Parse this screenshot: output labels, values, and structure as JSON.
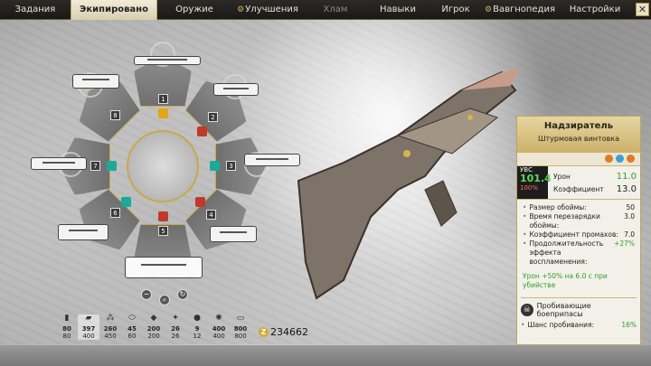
{
  "tabs": [
    {
      "label": "Задания",
      "state": "normal"
    },
    {
      "label": "Экипировано",
      "state": "active"
    },
    {
      "label": "Оружие",
      "state": "normal"
    },
    {
      "label": "Улучшения",
      "state": "normal",
      "icon": "gear-icon"
    },
    {
      "label": "Хлам",
      "state": "dim"
    },
    {
      "label": "Навыки",
      "state": "normal"
    },
    {
      "label": "Игрок",
      "state": "normal"
    },
    {
      "label": "Вавгнопедия",
      "state": "normal",
      "icon": "gear-icon"
    },
    {
      "label": "Настройки",
      "state": "normal"
    }
  ],
  "wheel": {
    "slots": [
      "1",
      "2",
      "3",
      "4",
      "5",
      "6",
      "7",
      "8"
    ],
    "center_buttons": [
      "−",
      "⌕",
      "↻"
    ]
  },
  "weapon": {
    "name": "Надзиратель",
    "type": "Штурмовая винтовка",
    "uvs_label": "УВС",
    "uvs_value": "101.4",
    "uvs_pct": "100%",
    "damage_label": "Урон",
    "damage_value": "11.0",
    "coef_label": "Коэффициент",
    "coef_value": "13.0",
    "stats": [
      {
        "label": "Размер обоймы:",
        "value": "50"
      },
      {
        "label": "Время перезарядки обоймы:",
        "value": "3.0"
      },
      {
        "label": "Коэффициент промахов:",
        "value": "7.0"
      },
      {
        "label": "Продолжительность эффекта воспламенения:",
        "value": "+27%"
      }
    ],
    "perk_a": "Урон +50% на 6.0 с при",
    "perk_b": "убийстве",
    "ammo_title": "Пробивающие боеприпасы",
    "pierce_label": "Шанс пробивания:",
    "pierce_value": "16%"
  },
  "ammo": [
    {
      "icon": "bullet-icon",
      "top": "80",
      "bottom": "80"
    },
    {
      "icon": "rifle-ammo-icon",
      "top": "397",
      "bottom": "400"
    },
    {
      "icon": "shell-icon",
      "top": "260",
      "bottom": "450"
    },
    {
      "icon": "cartridge-icon",
      "top": "45",
      "bottom": "60"
    },
    {
      "icon": "rocket-icon",
      "top": "200",
      "bottom": "200"
    },
    {
      "icon": "gear-ammo-icon",
      "top": "26",
      "bottom": "26"
    },
    {
      "icon": "grenade-icon",
      "top": "9",
      "bottom": "12"
    },
    {
      "icon": "saw-blade-icon",
      "top": "400",
      "bottom": "400"
    },
    {
      "icon": "battery-icon",
      "top": "800",
      "bottom": "800"
    }
  ],
  "currency": {
    "symbol": "Z",
    "value": "234662"
  },
  "colors": {
    "accent_gold": "#c9a84a",
    "damage_green": "#2f9e2f",
    "gem_red": "#c0392b",
    "gem_teal": "#1aa99a"
  }
}
